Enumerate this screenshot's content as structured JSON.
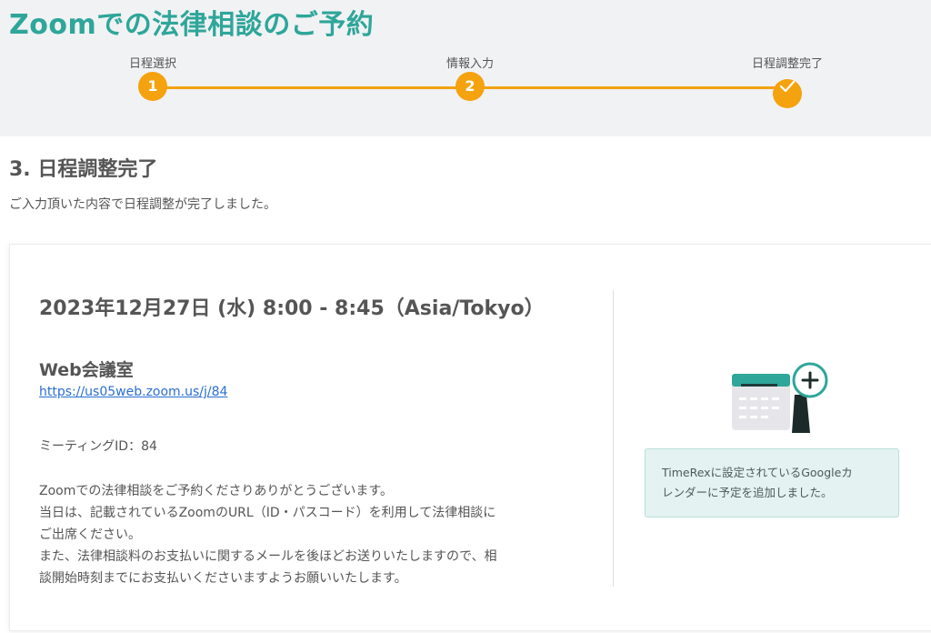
{
  "header": {
    "title": "Zoomでの法律相談のご予約",
    "steps": [
      {
        "label": "日程選択",
        "number": "1"
      },
      {
        "label": "情報入力",
        "number": "2"
      },
      {
        "label": "日程調整完了",
        "number": "check-icon"
      }
    ]
  },
  "main": {
    "section_title": "3. 日程調整完了",
    "section_description": "ご入力頂いた内容で日程調整が完了しました。",
    "card": {
      "event_datetime": "2023年12月27日 (水) 8:00 - 8:45（Asia/Tokyo）",
      "web_room_title": "Web会議室",
      "meeting_link": "https://us05web.zoom.us/j/84",
      "meeting_id": "ミーティングID：84",
      "message_lines": [
        "Zoomでの法律相談をご予約くださりありがとうございます。",
        "当日は、記載されているZoomのURL（ID・パスコード）を利用して法律相談に",
        "ご出席ください。",
        "また、法律相談料のお支払いに関するメールを後ほどお送りいたしますので、相",
        "談開始時刻までにお支払いくださいますようお願いいたします。"
      ],
      "calendar_icon": "calendar-add-icon",
      "notice_lines": [
        "TimeRexに設定されているGoogleカ",
        "レンダーに予定を追加しました。"
      ]
    }
  },
  "colors": {
    "title_teal": "#2ea69a",
    "step_orange": "#f5a20f",
    "header_bg": "#f1f2f4",
    "notice_bg": "#e4f3f1",
    "link_blue": "#2a6fd1"
  }
}
